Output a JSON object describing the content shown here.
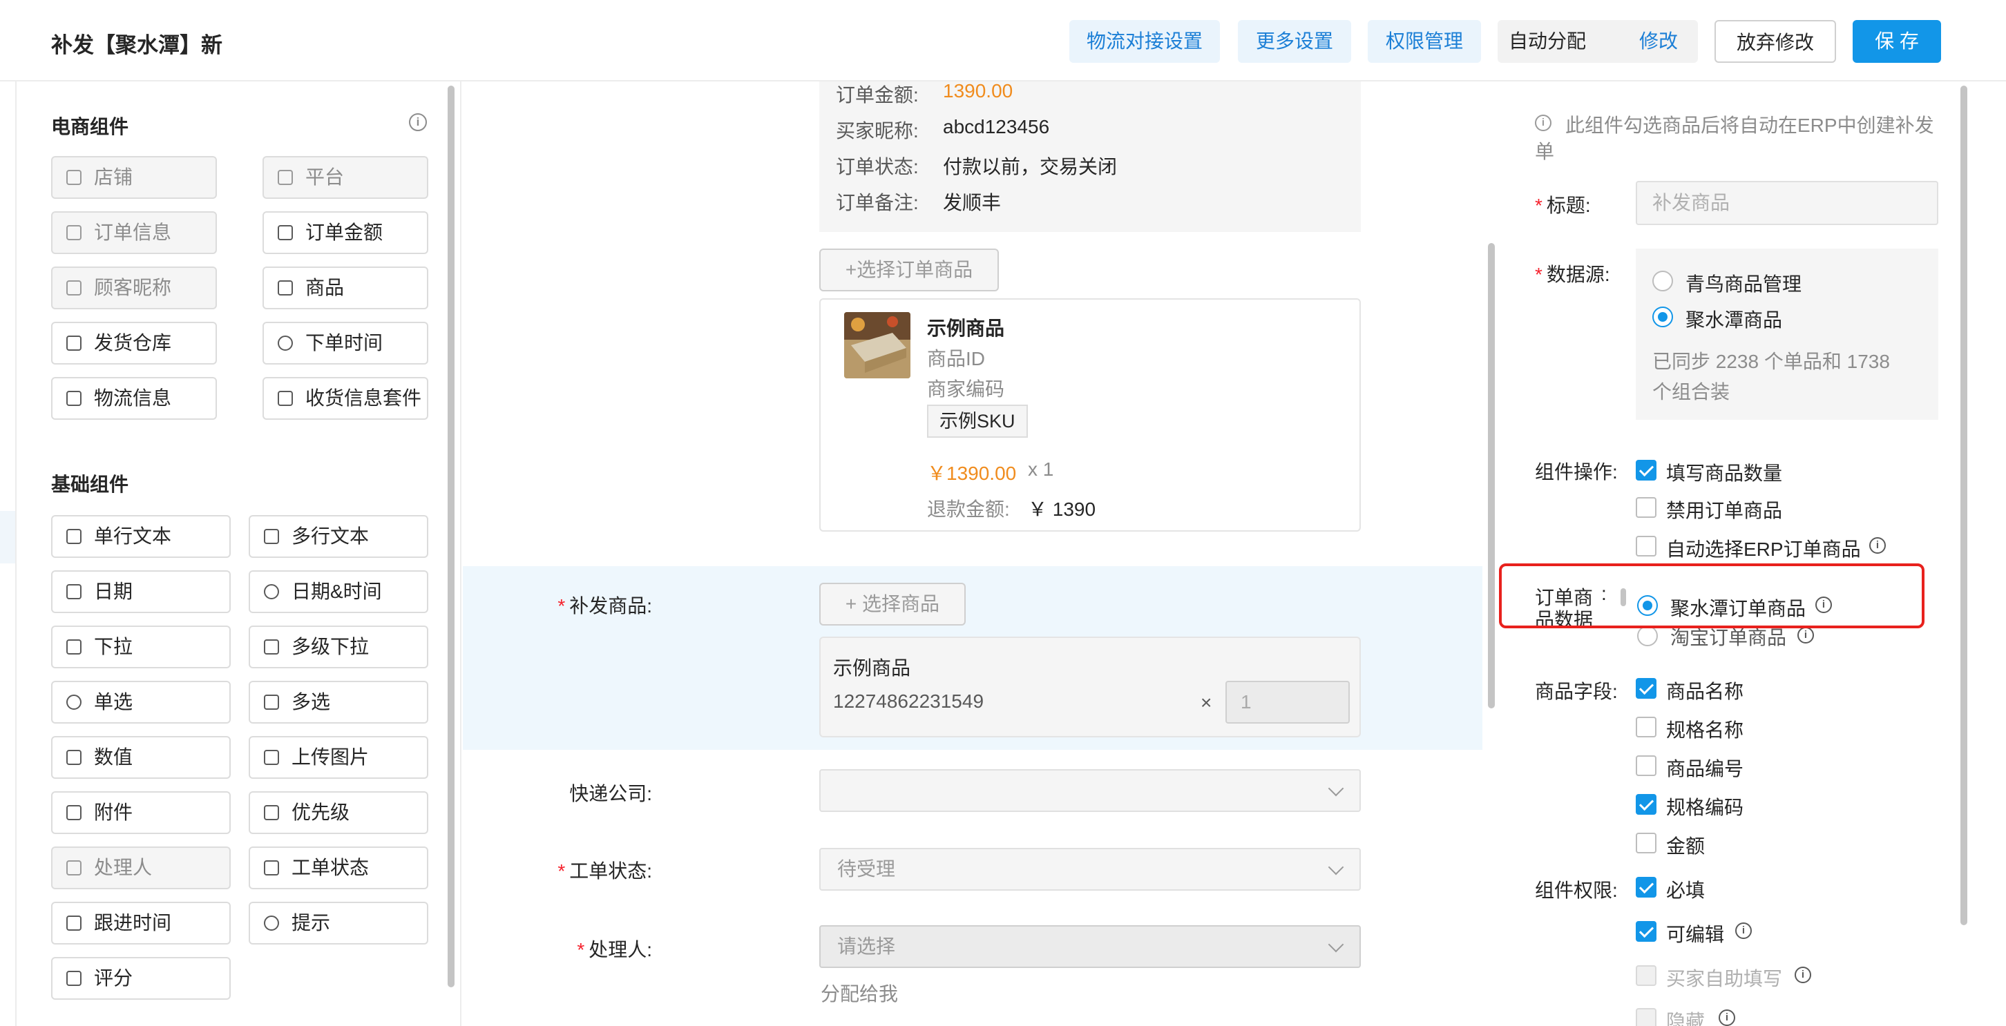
{
  "header": {
    "title": "补发【聚水潭】新",
    "buttons": {
      "logistics": "物流对接设置",
      "more": "更多设置",
      "permission": "权限管理",
      "auto_assign": "自动分配",
      "modify": "修改",
      "abandon": "放弃修改",
      "save": "保 存"
    }
  },
  "left": {
    "ecom_title": "电商组件",
    "ecom_items": [
      "店铺",
      "平台",
      "订单信息",
      "订单金额",
      "顾客昵称",
      "商品",
      "发货仓库",
      "下单时间",
      "物流信息",
      "收货信息套件"
    ],
    "basic_title": "基础组件",
    "basic_items": [
      "单行文本",
      "多行文本",
      "日期",
      "日期&时间",
      "下拉",
      "多级下拉",
      "单选",
      "多选",
      "数值",
      "上传图片",
      "附件",
      "优先级",
      "处理人",
      "工单状态",
      "跟进时间",
      "提示",
      "评分"
    ]
  },
  "order": {
    "amount_label": "订单金额:",
    "amount_value": "1390.00",
    "nick_label": "买家昵称:",
    "nick_value": "abcd123456",
    "status_label": "订单状态:",
    "status_value": "付款以前，交易关闭",
    "remark_label": "订单备注:",
    "remark_value": "发顺丰",
    "select_btn": "+选择订单商品",
    "product": {
      "name": "示例商品",
      "id_label": "商品ID",
      "code_label": "商家编码",
      "sku": "示例SKU",
      "price": "￥1390.00",
      "qty": "x 1",
      "refund_label": "退款金额:",
      "refund_value": "￥ 1390"
    }
  },
  "form": {
    "supplement_label": "补发商品:",
    "supplement_btn": "+ 选择商品",
    "supplement_name": "示例商品",
    "supplement_id": "12274862231549",
    "times": "×",
    "qty": "1",
    "express_label": "快递公司:",
    "status_label": "工单状态:",
    "status_value": "待受理",
    "handler_label": "处理人:",
    "handler_placeholder": "请选择",
    "assign_me": "分配给我"
  },
  "right": {
    "tip": "此组件勾选商品后将自动在ERP中创建补发",
    "tip2": "单",
    "title_label": "标题:",
    "title_placeholder": "补发商品",
    "source_label": "数据源:",
    "source_options": [
      "青鸟商品管理",
      "聚水潭商品"
    ],
    "synced": "已同步 2238 个单品和 1738",
    "synced2": "个组合装",
    "ops_label": "组件操作:",
    "ops": [
      "填写商品数量",
      "禁用订单商品",
      "自动选择ERP订单商品"
    ],
    "order_data_label1": "订单商",
    "order_data_label2": "品数据",
    "colon": ":",
    "order_data_options": [
      "聚水潭订单商品",
      "淘宝订单商品"
    ],
    "fields_label": "商品字段:",
    "fields": [
      "商品名称",
      "规格名称",
      "商品编号",
      "规格编码",
      "金额"
    ],
    "perm_label": "组件权限:",
    "perms": [
      "必填",
      "可编辑",
      "买家自助填写",
      "隐藏"
    ]
  },
  "colors": {
    "accent": "#1296e8",
    "orange": "#f08c1e",
    "highlight_box": "#e8211d"
  }
}
